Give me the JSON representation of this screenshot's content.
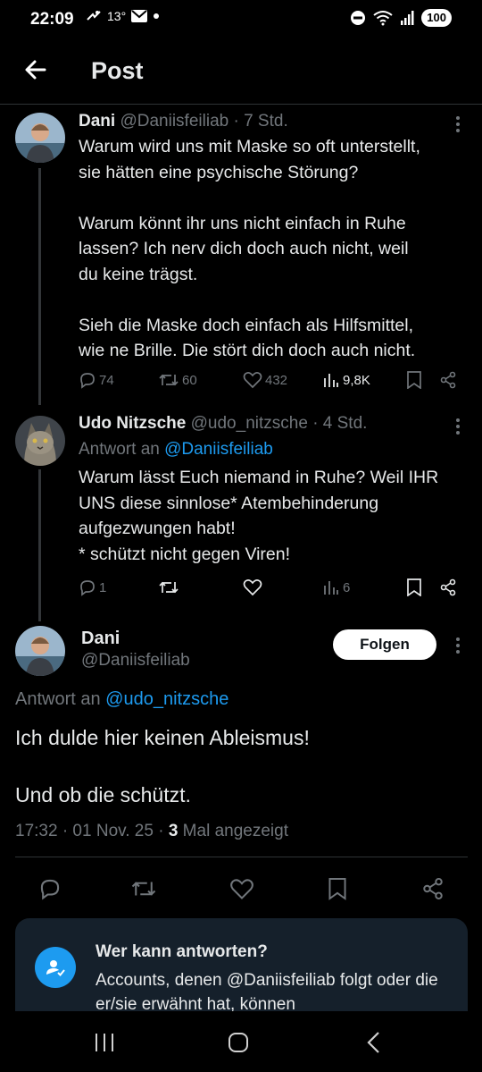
{
  "status_bar": {
    "time": "22:09",
    "temperature": "13°",
    "battery": "100",
    "icons": [
      "fan-icon",
      "mail-icon",
      "dot-icon",
      "do-not-disturb-icon",
      "wifi-icon",
      "signal-icon"
    ]
  },
  "header": {
    "title": "Post",
    "back_icon": "arrow-left-icon"
  },
  "tweets": [
    {
      "name": "Dani",
      "handle": "@Daniisfeiliab",
      "time": "· 7 Std.",
      "lines": [
        "Warum wird uns mit Maske so oft unterstellt,",
        "sie hätten eine psychische Störung?",
        "",
        "Warum könnt ihr uns nicht einfach in Ruhe",
        "lassen? Ich nerv dich doch auch nicht, weil",
        "du keine trägst.",
        "",
        "Sieh die Maske doch einfach als Hilfsmittel,",
        "wie ne Brille. Die stört dich doch auch nicht."
      ],
      "replies": "74",
      "reposts": "60",
      "likes": "432",
      "views": "9,8K"
    },
    {
      "name": "Udo Nitzsche",
      "handle": "@udo_nitzsche",
      "time": "· 4 Std.",
      "reply_prefix": "Antwort an",
      "reply_to": "@Daniisfeiliab",
      "lines": [
        "Warum lässt Euch niemand in Ruhe? Weil IHR",
        "UNS diese sinnlose* Atembehinderung",
        "aufgezwungen habt!",
        "* schützt nicht gegen Viren!"
      ],
      "replies": "1",
      "reposts": "",
      "likes": "",
      "views": "6"
    }
  ],
  "main_post": {
    "name": "Dani",
    "handle": "@Daniisfeiliab",
    "follow_label": "Folgen",
    "reply_prefix": "Antwort an",
    "reply_to": "@udo_nitzsche",
    "line1": "Ich dulde hier keinen Ableismus!",
    "line2": "Und ob die schützt.",
    "datetime": "17:32 · 01 Nov. 25 ·",
    "view_count": "3",
    "view_suffix": "Mal angezeigt"
  },
  "reply_card": {
    "title": "Wer kann antworten?",
    "text": "Accounts, denen @Daniisfeiliab folgt oder die er/sie erwähnt hat, können"
  },
  "colors": {
    "background": "#000000",
    "text": "#e7e9ea",
    "muted": "#71767b",
    "link": "#1d9bf0",
    "card": "#15202b"
  }
}
